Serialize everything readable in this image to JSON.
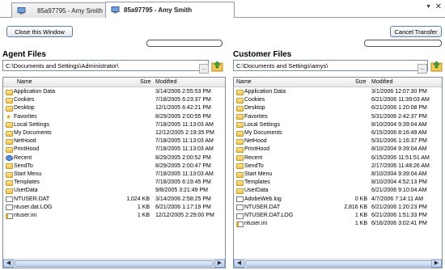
{
  "tabs": [
    {
      "label": "85a97795 - Amy Smith"
    },
    {
      "label": "85a97795 - Amy Smith"
    }
  ],
  "left": {
    "button": "Close this Window",
    "title": "Agent Files",
    "path": "C:\\Documents and Settings\\Administrator\\",
    "browse": "...",
    "columns": {
      "name": "Name",
      "size": "Size",
      "modified": "Modified"
    },
    "rows": [
      {
        "icon": "folder",
        "name": "Application Data",
        "size": "",
        "modified": "3/14/2006 2:55:53 PM"
      },
      {
        "icon": "folder",
        "name": "Cookies",
        "size": "",
        "modified": "7/18/2005 6:23:37 PM"
      },
      {
        "icon": "folder",
        "name": "Desktop",
        "size": "",
        "modified": "12/1/2005 6:42:21 PM"
      },
      {
        "icon": "star",
        "name": "Favorites",
        "size": "",
        "modified": "8/29/2005 2:00:55 PM"
      },
      {
        "icon": "folder",
        "name": "Local Settings",
        "size": "",
        "modified": "7/18/2005 11:13:03 AM"
      },
      {
        "icon": "folder",
        "name": "My Documents",
        "size": "",
        "modified": "12/12/2005 2:19:35 PM"
      },
      {
        "icon": "folder",
        "name": "NetHood",
        "size": "",
        "modified": "7/18/2005 11:13:03 AM"
      },
      {
        "icon": "folder",
        "name": "PrintHood",
        "size": "",
        "modified": "7/18/2005 11:13:03 AM"
      },
      {
        "icon": "recent",
        "name": "Recent",
        "size": "",
        "modified": "8/29/2005 2:00:52 PM"
      },
      {
        "icon": "folder",
        "name": "SendTo",
        "size": "",
        "modified": "8/29/2005 2:00:47 PM"
      },
      {
        "icon": "folder",
        "name": "Start Menu",
        "size": "",
        "modified": "7/18/2005 11:13:03 AM"
      },
      {
        "icon": "folder",
        "name": "Templates",
        "size": "",
        "modified": "7/18/2005 6:19:45 PM"
      },
      {
        "icon": "folder",
        "name": "UserData",
        "size": "",
        "modified": "9/8/2005 3:21:49 PM"
      },
      {
        "icon": "file",
        "name": "NTUSER.DAT",
        "size": "1,024 KB",
        "modified": "3/14/2006 2:58:25 PM"
      },
      {
        "icon": "file",
        "name": "ntuser.dat.LOG",
        "size": "1 KB",
        "modified": "6/21/2006 1:17:19 PM"
      },
      {
        "icon": "ini",
        "name": "ntuser.ini",
        "size": "1 KB",
        "modified": "12/12/2005 2:29:00 PM"
      }
    ]
  },
  "right": {
    "button": "Cancel Transfer",
    "title": "Customer Files",
    "path": "C:\\Documents and Settings\\amys\\",
    "browse": "...",
    "columns": {
      "name": "Name",
      "size": "Size",
      "modified": "Modified"
    },
    "rows": [
      {
        "icon": "folder",
        "name": "Application Data",
        "size": "",
        "modified": "3/1/2006 12:07:30 PM"
      },
      {
        "icon": "folder",
        "name": "Cookies",
        "size": "",
        "modified": "6/21/2006 11:39:03 AM"
      },
      {
        "icon": "folder",
        "name": "Desktop",
        "size": "",
        "modified": "6/21/2006 1:20:08 PM"
      },
      {
        "icon": "folder",
        "name": "Favorites",
        "size": "",
        "modified": "5/31/2006 2:42:37 PM"
      },
      {
        "icon": "folder",
        "name": "Local Settings",
        "size": "",
        "modified": "8/10/2004 9:39:04 AM"
      },
      {
        "icon": "folder",
        "name": "My Documents",
        "size": "",
        "modified": "6/15/2006 8:16:49 AM"
      },
      {
        "icon": "folder",
        "name": "NetHood",
        "size": "",
        "modified": "5/31/2006 1:16:37 PM"
      },
      {
        "icon": "folder",
        "name": "PrintHood",
        "size": "",
        "modified": "8/10/2004 9:39:04 AM"
      },
      {
        "icon": "folder",
        "name": "Recent",
        "size": "",
        "modified": "6/15/2006 11:51:51 AM"
      },
      {
        "icon": "folder",
        "name": "SendTo",
        "size": "",
        "modified": "2/17/2006 11:48:26 AM"
      },
      {
        "icon": "folder",
        "name": "Start Menu",
        "size": "",
        "modified": "8/10/2004 9:39:04 AM"
      },
      {
        "icon": "folder",
        "name": "Templates",
        "size": "",
        "modified": "8/10/2004 4:52:13 PM"
      },
      {
        "icon": "folder",
        "name": "UserData",
        "size": "",
        "modified": "6/21/2006 9:10:04 AM"
      },
      {
        "icon": "file",
        "name": "AdobeWeb.log",
        "size": "0 KB",
        "modified": "4/7/2006 7:14:11 AM"
      },
      {
        "icon": "file",
        "name": "NTUSER.DAT",
        "size": "2,816 KB",
        "modified": "6/21/2006 1:20:23 PM"
      },
      {
        "icon": "file",
        "name": "NTUSER.DAT.LOG",
        "size": "1 KB",
        "modified": "6/21/2006 1:51:33 PM"
      },
      {
        "icon": "ini",
        "name": "ntuser.ini",
        "size": "1 KB",
        "modified": "6/16/2006 3:02:41 PM"
      }
    ]
  }
}
